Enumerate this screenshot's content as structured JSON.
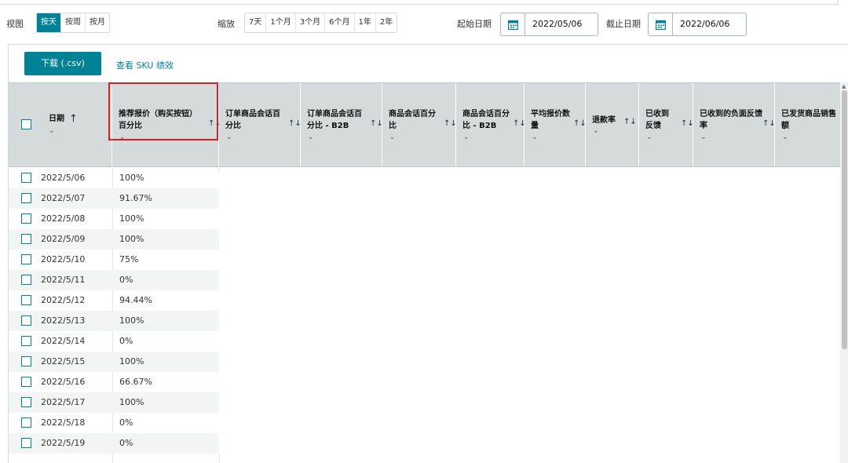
{
  "toolbar": {
    "view_label": "视图",
    "view_options": [
      "按天",
      "按周",
      "按月"
    ],
    "zoom_label": "缩放",
    "zoom_options": [
      "7天",
      "1个月",
      "3个月",
      "6个月",
      "1年",
      "2年"
    ],
    "start_label": "起始日期",
    "start_date": "2022/05/06",
    "end_label": "截止日期",
    "end_date": "2022/06/06",
    "calendar_icon": "calendar-icon"
  },
  "actions": {
    "download_label": "下载 (.csv)",
    "sku_link_label": "查看 SKU 绩效"
  },
  "columns": [
    {
      "title": "日期",
      "sort": "↑"
    },
    {
      "title": "推荐报价（购买按钮）百分比",
      "sort": "↑↓"
    },
    {
      "title": "订单商品会话百分比",
      "sort": "↑↓"
    },
    {
      "title": "订单商品会话百分比 - B2B",
      "sort": "↑↓"
    },
    {
      "title": "商品会话百分比",
      "sort": "↑↓"
    },
    {
      "title": "商品会话百分比 - B2B",
      "sort": "↑↓"
    },
    {
      "title": "平均报价数量",
      "sort": "↑↓"
    },
    {
      "title": "退款率",
      "sort": "↑↓"
    },
    {
      "title": "已收到反馈",
      "sort": "↑↓"
    },
    {
      "title": "已收到的负面反馈率",
      "sort": "↑↓"
    },
    {
      "title": "已发货商品销售额",
      "sort": ""
    }
  ],
  "rows": [
    {
      "date": "2022/5/06",
      "value": "100%"
    },
    {
      "date": "2022/5/07",
      "value": "91.67%"
    },
    {
      "date": "2022/5/08",
      "value": "100%"
    },
    {
      "date": "2022/5/09",
      "value": "100%"
    },
    {
      "date": "2022/5/10",
      "value": "75%"
    },
    {
      "date": "2022/5/11",
      "value": "0%"
    },
    {
      "date": "2022/5/12",
      "value": "94.44%"
    },
    {
      "date": "2022/5/13",
      "value": "100%"
    },
    {
      "date": "2022/5/14",
      "value": "0%"
    },
    {
      "date": "2022/5/15",
      "value": "100%"
    },
    {
      "date": "2022/5/16",
      "value": "66.67%"
    },
    {
      "date": "2022/5/17",
      "value": "100%"
    },
    {
      "date": "2022/5/18",
      "value": "0%"
    },
    {
      "date": "2022/5/19",
      "value": "0%"
    }
  ],
  "colors": {
    "accent": "#008296",
    "header_bg": "#d5dbdb",
    "highlight": "#e11b22"
  }
}
